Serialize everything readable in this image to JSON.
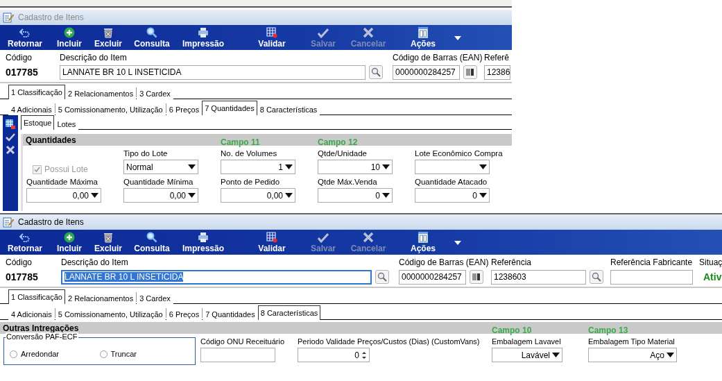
{
  "windows": [
    {
      "title": "Cadastro de Itens",
      "active": false,
      "toolbar": {
        "more_menu": true,
        "buttons": [
          {
            "label": "Retornar",
            "disabled": false
          },
          {
            "label": "Incluir",
            "disabled": false
          },
          {
            "label": "Excluir",
            "disabled": false
          },
          {
            "label": "Consulta",
            "disabled": false
          },
          {
            "label": "Impressão",
            "disabled": false
          },
          {
            "label": "Validar",
            "disabled": false
          },
          {
            "label": "Salvar",
            "disabled": true
          },
          {
            "label": "Cancelar",
            "disabled": true
          },
          {
            "label": "Ações",
            "disabled": false
          }
        ]
      },
      "header": [
        {
          "kind": "code",
          "label": "Código",
          "value": "017785"
        },
        {
          "kind": "search-input",
          "label": "Descrição do Item",
          "value": "LANNATE BR 10 L INSETICIDA",
          "selected": false
        },
        {
          "kind": "barcode-input",
          "label": "Código de Barras (EAN)",
          "value": "0000000284257"
        },
        {
          "kind": "input",
          "label": "Referê",
          "value": "12386"
        }
      ],
      "tab_rows": [
        {
          "tabs": [
            {
              "label": "1 Classificação",
              "selected": true
            },
            {
              "label": "2 Relacionamentos",
              "selected": false
            },
            {
              "label": "3 Cardex",
              "selected": false
            }
          ]
        },
        {
          "tabs": [
            {
              "label": "4 Adicionais",
              "selected": false
            },
            {
              "label": "5 Comissionamento, Utilização",
              "selected": false
            },
            {
              "label": "6 Preços",
              "selected": false
            },
            {
              "label": "7 Quantidades",
              "selected": true
            },
            {
              "label": "8 Características",
              "selected": false
            }
          ]
        }
      ],
      "panel": {
        "kind": "stock",
        "subtabs": [
          {
            "label": "Estoque",
            "selected": true
          },
          {
            "label": "Lotes",
            "selected": false
          }
        ],
        "group": "Quantidades",
        "rows": [
          [
            {
              "kind": "checkbox",
              "label": "Possui Lote",
              "checked": true,
              "disabled": true
            },
            {
              "kind": "combo-left",
              "label": "Tipo do Lote",
              "value": "Normal"
            },
            {
              "kind": "combo",
              "label": "No. de Volumes",
              "value": "1",
              "annotation": "Campo 11"
            },
            {
              "kind": "combo",
              "label": "Qtde/Unidade",
              "value": "10",
              "annotation": "Campo 12"
            },
            {
              "kind": "combo",
              "label": "Lote Econômico Compra"
            }
          ],
          [
            {
              "kind": "combo",
              "label": "Quantidade Máxima",
              "value": "0,00"
            },
            {
              "kind": "combo",
              "label": "Quantidade Mínima",
              "value": "0,00"
            },
            {
              "kind": "combo",
              "label": "Ponto de Pedido",
              "value": "0,00"
            },
            {
              "kind": "combo",
              "label": "Qtde Máx.Venda",
              "value": "0"
            },
            {
              "kind": "combo",
              "label": "Quantidade Atacado",
              "value": "0"
            }
          ]
        ]
      }
    },
    {
      "title": "Cadastro de Itens",
      "active": true,
      "toolbar": {
        "more_menu": true,
        "buttons": [
          {
            "label": "Retornar",
            "disabled": false
          },
          {
            "label": "Incluir",
            "disabled": false
          },
          {
            "label": "Excluir",
            "disabled": false
          },
          {
            "label": "Consulta",
            "disabled": false
          },
          {
            "label": "Impressão",
            "disabled": false
          },
          {
            "label": "Validar",
            "disabled": false
          },
          {
            "label": "Salvar",
            "disabled": true
          },
          {
            "label": "Cancelar",
            "disabled": true
          },
          {
            "label": "Ações",
            "disabled": false
          }
        ]
      },
      "header": [
        {
          "kind": "code",
          "label": "Código",
          "value": "017785"
        },
        {
          "kind": "search-input",
          "label": "Descrição do Item",
          "value": "LANNATE BR 10 L INSETICIDA",
          "selected": true
        },
        {
          "kind": "barcode-input",
          "label": "Código de Barras (EAN)",
          "value": "0000000284257"
        },
        {
          "kind": "search-input",
          "label": "Referência",
          "value": "1238603"
        },
        {
          "kind": "input",
          "label": "Referência Fabricante"
        },
        {
          "kind": "status",
          "label": "Situaç",
          "value": "Ativ"
        }
      ],
      "tab_rows": [
        {
          "tabs": [
            {
              "label": "1 Classificação",
              "selected": true
            },
            {
              "label": "2 Relacionamentos",
              "selected": false
            },
            {
              "label": "3 Cardex",
              "selected": false
            }
          ]
        },
        {
          "tabs": [
            {
              "label": "4 Adicionais",
              "selected": false
            },
            {
              "label": "5 Comissionamento, Utilização",
              "selected": false
            },
            {
              "label": "6 Preços",
              "selected": false
            },
            {
              "label": "7 Quantidades",
              "selected": false
            },
            {
              "label": "8 Características",
              "selected": true
            }
          ]
        }
      ],
      "panel": {
        "kind": "other",
        "group": "Outras Intregações",
        "rows": [
          [
            {
              "kind": "radio-group",
              "label": "Conversão PAF-ECF",
              "options": [
                {
                  "label": "Arredondar",
                  "selected": false
                },
                {
                  "label": "Truncar",
                  "selected": false
                }
              ]
            },
            {
              "kind": "input",
              "label": "Código ONU Receituário"
            },
            {
              "kind": "spin",
              "label": "Periodo Validade Preços/Custos (Dias) (CustomVans)",
              "value": "0"
            },
            {
              "kind": "combo",
              "label": "Embalagem Lavavel",
              "value": "Lavável",
              "annotation": "Campo 10"
            },
            {
              "kind": "combo",
              "label": "Embalagem Tipo Material",
              "value": "Aço",
              "annotation": "Campo 13"
            }
          ]
        ]
      }
    }
  ]
}
